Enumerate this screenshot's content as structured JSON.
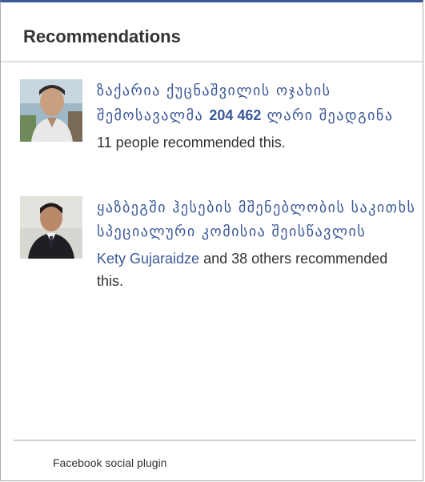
{
  "header": {
    "title": "Recommendations"
  },
  "items": [
    {
      "title_part1": "ზაქარია ქუცნაშვილის ოჯახის შემოსავალმა ",
      "title_amount": "204 462",
      "title_part2": " ლარი შეადგინა",
      "meta_text": "11 people recommended this."
    },
    {
      "title": "ყაზბეგში ჰესების მშენებლობის საკითხს სპეციალური კომისია შეისწავლის",
      "meta_link": "Kety Gujaraidze",
      "meta_text": " and 38 others recommended this."
    }
  ],
  "footer": {
    "label": "Facebook social plugin"
  },
  "colors": {
    "accent": "#3b5998",
    "text": "#333333",
    "border": "#aaaaaa"
  }
}
